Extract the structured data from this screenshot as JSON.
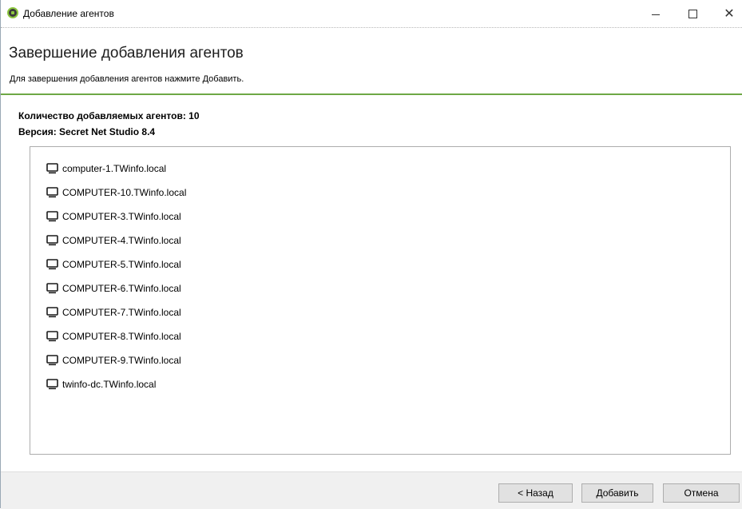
{
  "window": {
    "title": "Добавление агентов",
    "controls": {
      "minimize": "—",
      "maximize": "□",
      "close": "✕"
    }
  },
  "header": {
    "title": "Завершение добавления агентов",
    "subtitle": "Для завершения добавления агентов нажмите Добавить."
  },
  "summary": {
    "count_text": "Количество добавляемых агентов: 10",
    "version_text": "Версия: Secret Net Studio 8.4"
  },
  "agents": [
    {
      "name": "computer-1.TWinfo.local",
      "icon": "monitor-icon"
    },
    {
      "name": "COMPUTER-10.TWinfo.local",
      "icon": "monitor-icon"
    },
    {
      "name": "COMPUTER-3.TWinfo.local",
      "icon": "monitor-icon"
    },
    {
      "name": "COMPUTER-4.TWinfo.local",
      "icon": "monitor-icon"
    },
    {
      "name": "COMPUTER-5.TWinfo.local",
      "icon": "monitor-icon"
    },
    {
      "name": "COMPUTER-6.TWinfo.local",
      "icon": "monitor-icon"
    },
    {
      "name": "COMPUTER-7.TWinfo.local",
      "icon": "monitor-icon"
    },
    {
      "name": "COMPUTER-8.TWinfo.local",
      "icon": "monitor-icon"
    },
    {
      "name": "COMPUTER-9.TWinfo.local",
      "icon": "monitor-icon"
    },
    {
      "name": "twinfo-dc.TWinfo.local",
      "icon": "monitor-icon"
    }
  ],
  "footer": {
    "back_label": "< Назад",
    "add_label": "Добавить",
    "cancel_label": "Отмена"
  },
  "colors": {
    "accent_green": "#6ea845",
    "button_bg": "#e1e1e1",
    "footer_bg": "#f0f0f0"
  }
}
